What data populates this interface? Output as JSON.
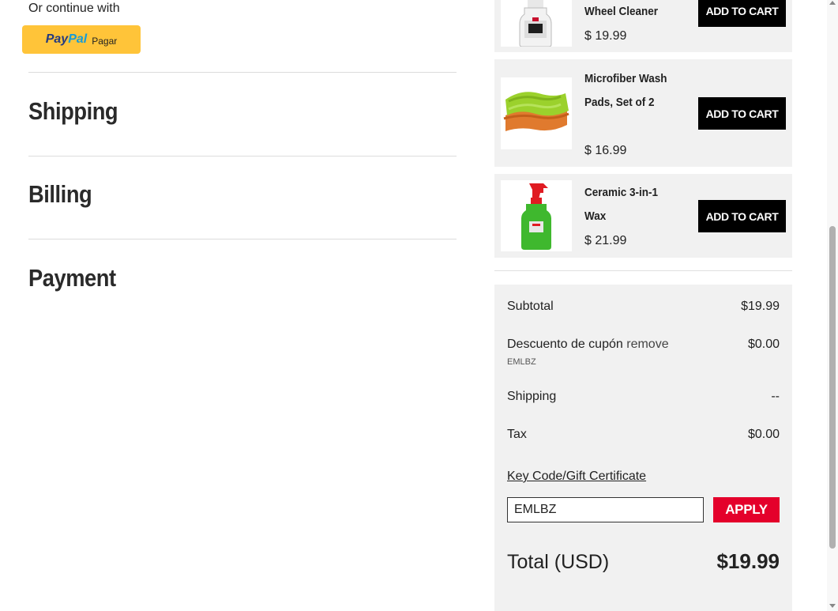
{
  "left": {
    "continue_text": "Or continue with",
    "paypal": {
      "brand_pay": "Pay",
      "brand_pal": "Pal",
      "label": "Pagar"
    },
    "sections": [
      "Shipping",
      "Billing",
      "Payment"
    ]
  },
  "products": [
    {
      "name": "Wheel Cleaner",
      "price": "$ 19.99",
      "button": "ADD TO CART",
      "icon": "spray-bottle-white-icon"
    },
    {
      "name": "Microfiber Wash Pads, Set of 2",
      "price": "$ 16.99",
      "button": "ADD TO CART",
      "icon": "wash-pads-icon"
    },
    {
      "name": "Ceramic 3-in-1 Wax",
      "price": "$ 21.99",
      "button": "ADD TO CART",
      "icon": "spray-bottle-green-icon"
    }
  ],
  "summary": {
    "subtotal_label": "Subtotal",
    "subtotal_value": "$19.99",
    "coupon_label": "Descuento de cupón",
    "coupon_remove": "remove",
    "coupon_value": "$0.00",
    "coupon_code": "EMLBZ",
    "shipping_label": "Shipping",
    "shipping_value": "--",
    "tax_label": "Tax",
    "tax_value": "$0.00",
    "keycode_link": "Key Code/Gift Certificate",
    "keycode_input_value": "EMLBZ",
    "apply_label": "APPLY",
    "total_label": "Total (USD)",
    "total_value": "$19.99"
  },
  "colors": {
    "accent_red": "#e4002b",
    "paypal_yellow": "#ffc439",
    "card_bg": "#f1f1f1"
  }
}
